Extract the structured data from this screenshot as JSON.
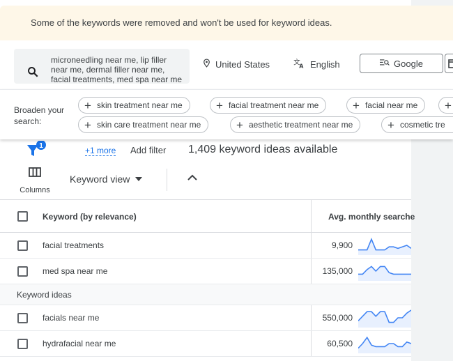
{
  "banner": {
    "message": "Some of the keywords were removed and won't be used for keyword ideas."
  },
  "search": {
    "keywords": "microneedling near me, lip filler near me, dermal filler near me, facial treatments, med spa near me",
    "location": "United States",
    "language": "English",
    "network": "Google"
  },
  "broaden": {
    "label": "Broaden your search:",
    "chips_row1": [
      "skin treatment near me",
      "facial treatment near me",
      "facial near me",
      ""
    ],
    "chips_row2": [
      "skin care treatment near me",
      "aesthetic treatment near me",
      "cosmetic tre"
    ]
  },
  "filters": {
    "more_link": "+1 more",
    "add_filter": "Add filter",
    "ideas_count": "1,409 keyword ideas available",
    "filter_badge": "1"
  },
  "view": {
    "columns_label": "Columns",
    "keyword_view": "Keyword view"
  },
  "table": {
    "col_keyword": "Keyword (by relevance)",
    "col_avg": "Avg. monthly searche",
    "provided_rows": [
      {
        "keyword": "facial treatments",
        "searches": "9,900",
        "trend": [
          2,
          2,
          2,
          9,
          2,
          2,
          2,
          4,
          4,
          3,
          4,
          5,
          3
        ]
      },
      {
        "keyword": "med spa near me",
        "searches": "135,000",
        "trend": [
          3,
          3,
          6,
          8,
          5,
          8,
          8,
          4,
          3,
          3,
          3,
          3,
          3
        ]
      }
    ],
    "section_label": "Keyword ideas",
    "idea_rows": [
      {
        "keyword": "facials near me",
        "searches": "550,000",
        "trend": [
          3,
          6,
          9,
          9,
          6,
          9,
          9,
          2,
          2,
          5,
          5,
          8,
          10
        ]
      },
      {
        "keyword": "hydrafacial near me",
        "searches": "60,500",
        "trend": [
          2,
          5,
          9,
          4,
          3,
          3,
          3,
          5,
          5,
          3,
          3,
          6,
          5
        ]
      }
    ]
  },
  "colors": {
    "accent": "#1a73e8",
    "sparkline": "#4285f4",
    "banner_bg": "#fef7e8"
  }
}
